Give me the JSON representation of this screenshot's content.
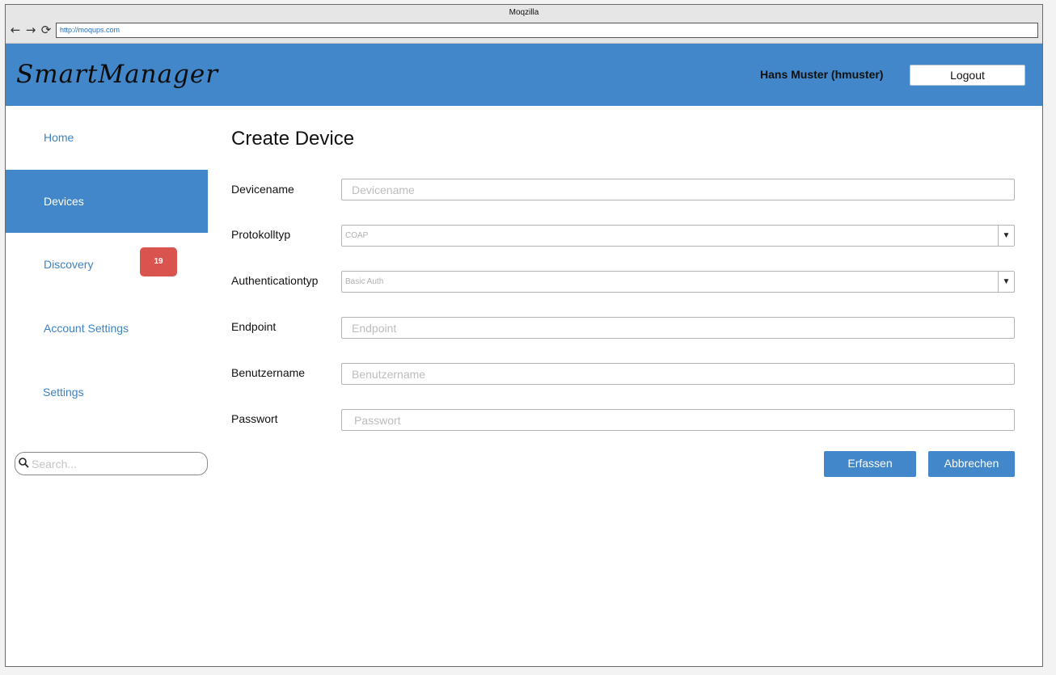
{
  "browser": {
    "title": "Moqzilla",
    "url": "http://moqups.com",
    "back_icon": "←",
    "forward_icon": "→",
    "reload_icon": "⟳"
  },
  "header": {
    "logo": "SmartManager",
    "user": "Hans Muster (hmuster)",
    "logout_label": "Logout"
  },
  "sidebar": {
    "items": [
      {
        "label": "Home"
      },
      {
        "label": "Devices"
      },
      {
        "label": "Discovery",
        "badge": "19"
      },
      {
        "label": "Account Settings"
      },
      {
        "label": "Settings"
      }
    ],
    "search_placeholder": "Search..."
  },
  "form": {
    "title": "Create Device",
    "devicename": {
      "label": "Devicename",
      "placeholder": "Devicename"
    },
    "protokolltyp": {
      "label": "Protokolltyp",
      "value": "COAP",
      "arrow": "▼"
    },
    "authenticationtyp": {
      "label": "Authenticationtyp",
      "value": "Basic Auth",
      "arrow": "▼"
    },
    "endpoint": {
      "label": "Endpoint",
      "placeholder": "Endpoint"
    },
    "benutzername": {
      "label": "Benutzername",
      "placeholder": "Benutzername"
    },
    "passwort": {
      "label": "Passwort",
      "placeholder": "Passwort"
    },
    "submit_label": "Erfassen",
    "cancel_label": "Abbrechen"
  },
  "colors": {
    "accent": "#4187c9",
    "badge": "#d9534f",
    "link": "#3b82c4"
  }
}
